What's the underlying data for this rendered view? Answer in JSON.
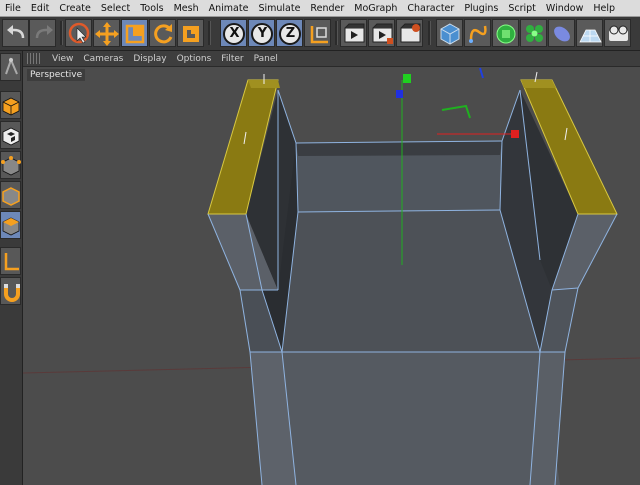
{
  "menu": [
    "File",
    "Edit",
    "Create",
    "Select",
    "Tools",
    "Mesh",
    "Animate",
    "Simulate",
    "Render",
    "MoGraph",
    "Character",
    "Plugins",
    "Script",
    "Window",
    "Help"
  ],
  "viewport": {
    "menu": [
      "View",
      "Cameras",
      "Display",
      "Options",
      "Filter",
      "Panel"
    ],
    "label": "Perspective"
  },
  "toolbar": {
    "axis_x": "X",
    "axis_y": "Y",
    "axis_z": "Z"
  },
  "colors": {
    "accent": "#6d88b8",
    "selected_face": "#8a7a12",
    "edge": "#8fb3e0",
    "axis_x": "#e02020",
    "axis_y": "#20c020",
    "axis_z": "#2040e0"
  }
}
